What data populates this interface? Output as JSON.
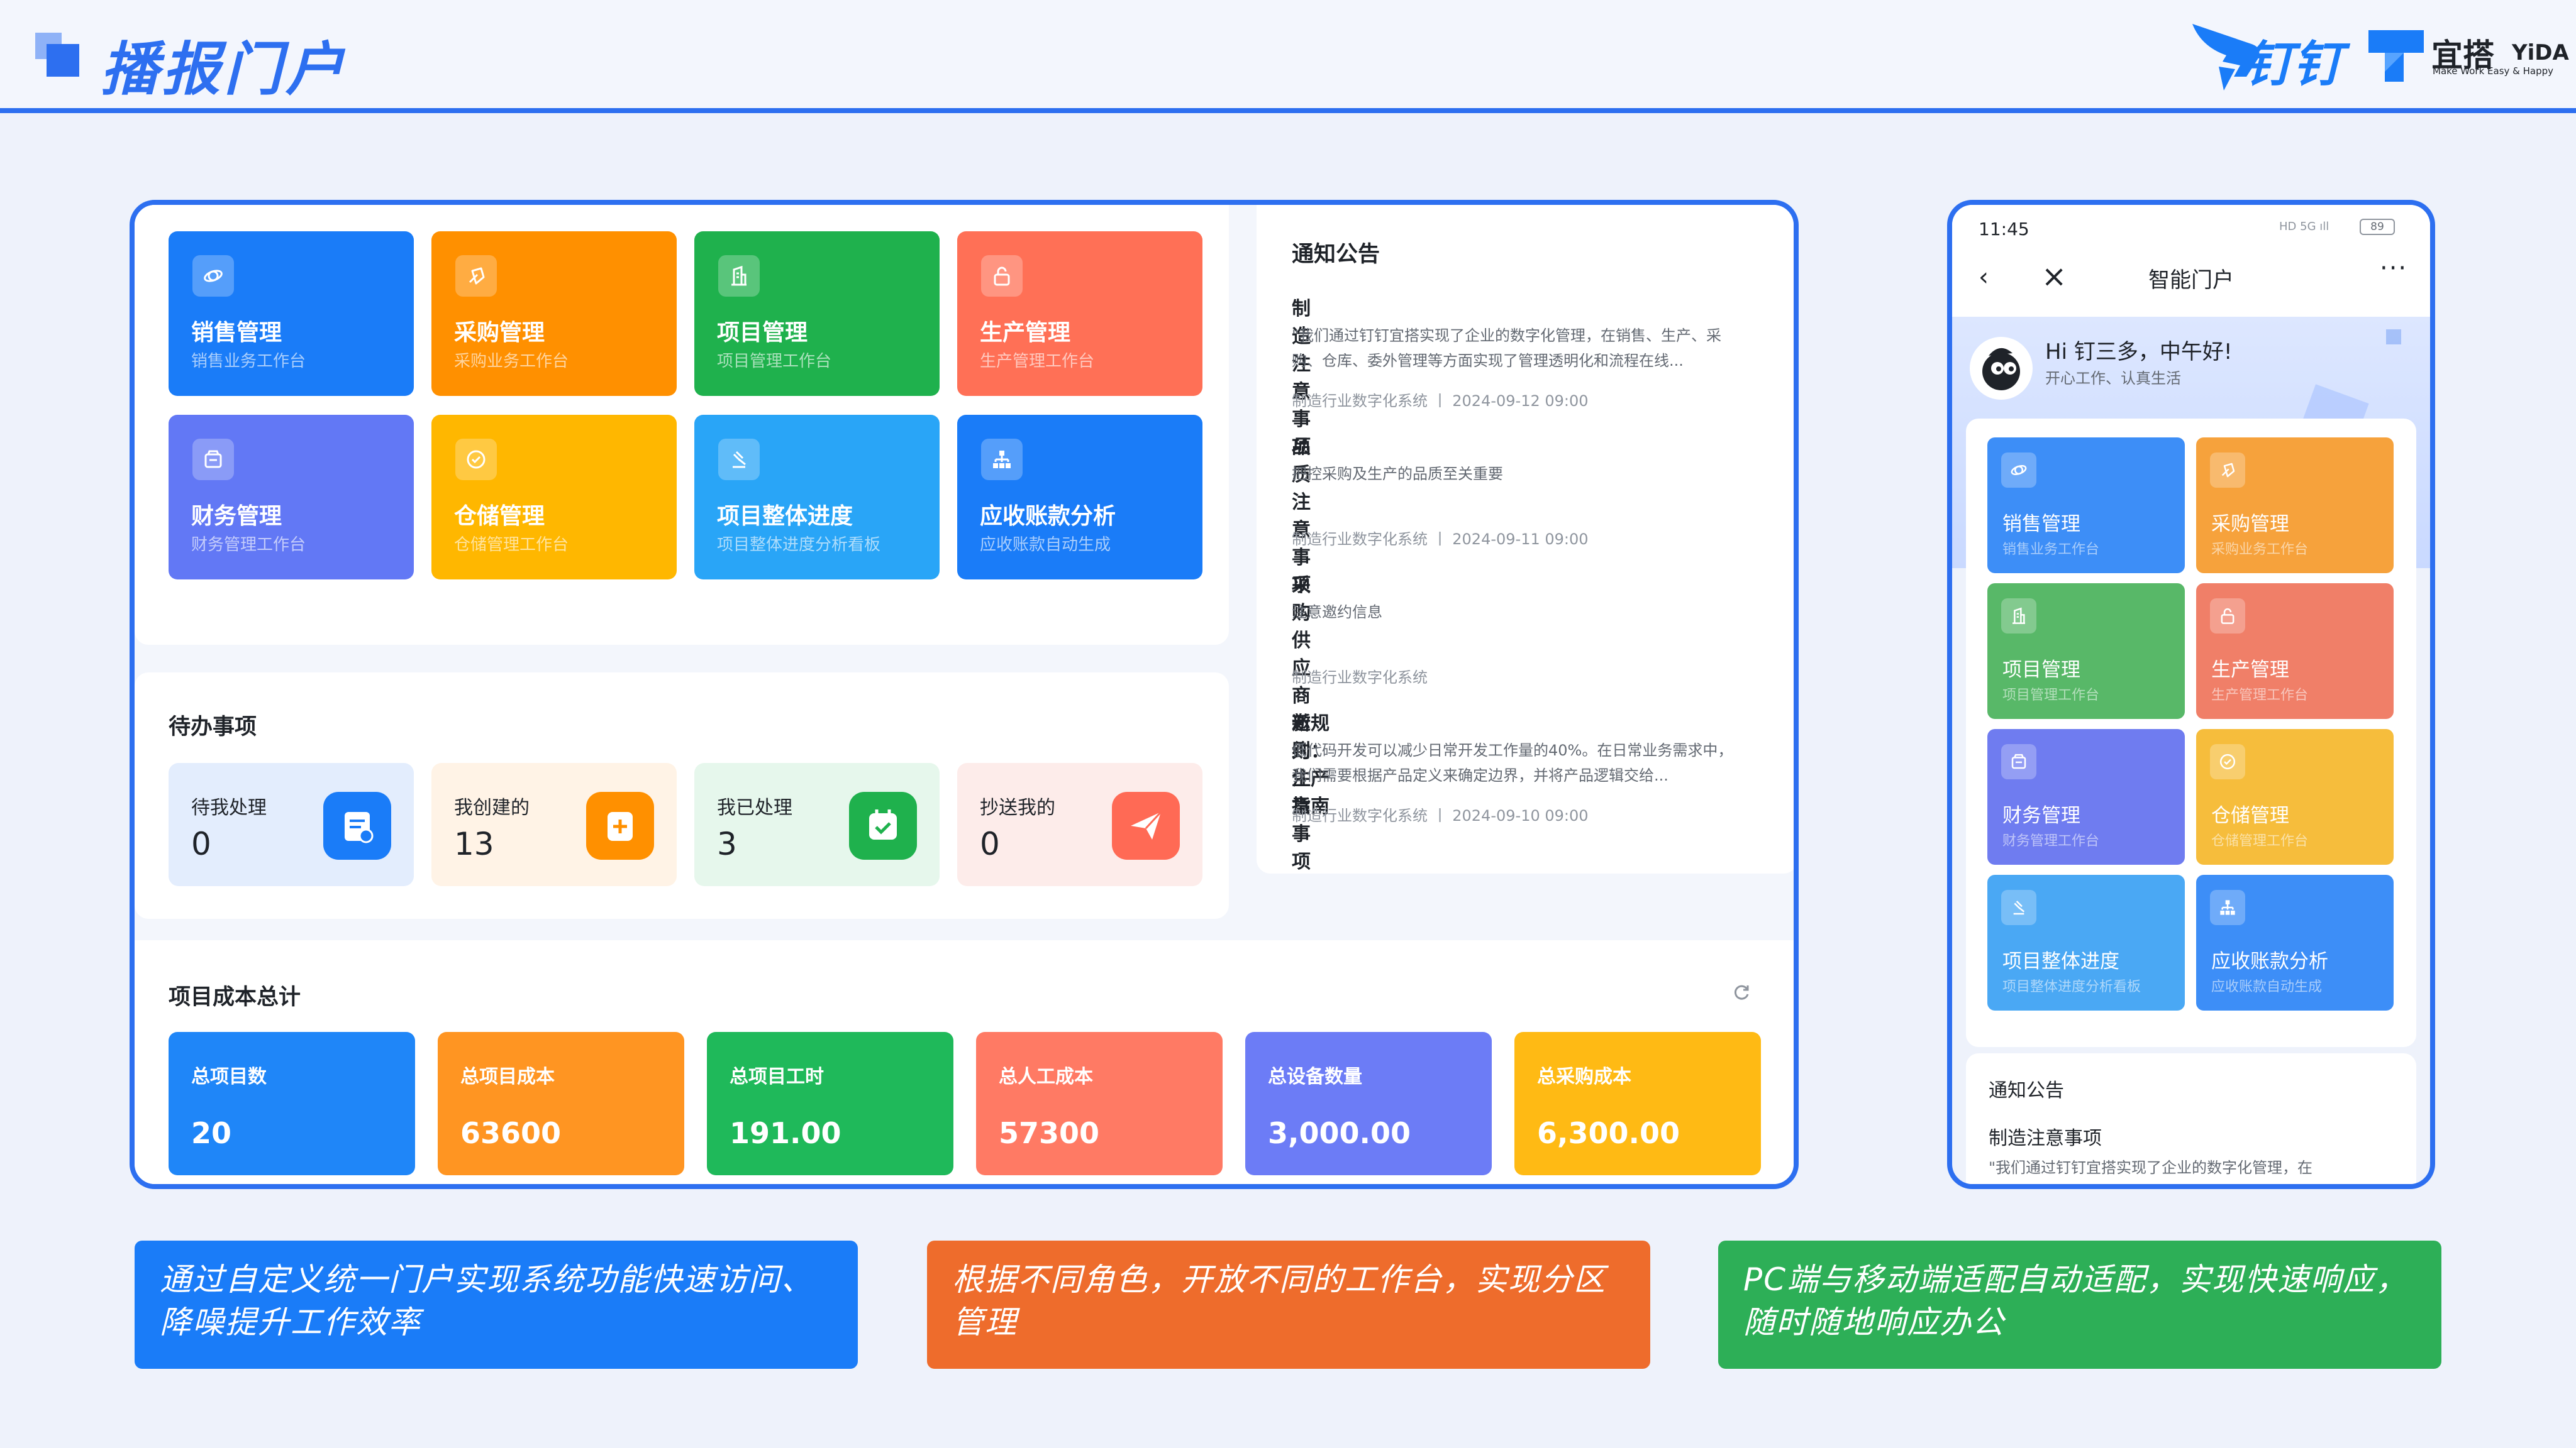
{
  "header": {
    "title": "播报门户",
    "dingtalk_label": "钉钉",
    "yida_cn": "宜搭",
    "yida_en": "YiDA",
    "yida_slogan": "Make Work Easy & Happy",
    "accent_color": "#2d6ff0"
  },
  "pc": {
    "apps": [
      {
        "title": "销售管理",
        "subtitle": "销售业务工作台",
        "color": "#1a7cf8",
        "icon": "planet-icon"
      },
      {
        "title": "采购管理",
        "subtitle": "采购业务工作台",
        "color": "#ff9000",
        "icon": "rocket-icon"
      },
      {
        "title": "项目管理",
        "subtitle": "项目管理工作台",
        "color": "#1fb14d",
        "icon": "building-icon"
      },
      {
        "title": "生产管理",
        "subtitle": "生产管理工作台",
        "color": "#ff7056",
        "icon": "lock-icon"
      },
      {
        "title": "财务管理",
        "subtitle": "财务管理工作台",
        "color": "#6278f5",
        "icon": "wallet-icon"
      },
      {
        "title": "仓储管理",
        "subtitle": "仓储管理工作台",
        "color": "#ffb700",
        "icon": "check-badge-icon"
      },
      {
        "title": "项目整体进度",
        "subtitle": "项目整体进度分析看板",
        "color": "#29a5f7",
        "icon": "gavel-icon"
      },
      {
        "title": "应收账款分析",
        "subtitle": "应收账款自动生成",
        "color": "#1a7cf8",
        "icon": "org-tree-icon"
      }
    ],
    "todo": {
      "title": "待办事项",
      "items": [
        {
          "label": "待我处理",
          "count": "0",
          "bg": "#e3edfd",
          "icon_bg": "#1a7cf8",
          "icon": "document-icon"
        },
        {
          "label": "我创建的",
          "count": "13",
          "bg": "#fff3e6",
          "icon_bg": "#ff9000",
          "icon": "clipboard-plus-icon"
        },
        {
          "label": "我已处理",
          "count": "3",
          "bg": "#e6f7ec",
          "icon_bg": "#1fb14d",
          "icon": "calendar-check-icon"
        },
        {
          "label": "抄送我的",
          "count": "0",
          "bg": "#fdecea",
          "icon_bg": "#ff6a55",
          "icon": "send-icon"
        }
      ]
    },
    "cost": {
      "title": "项目成本总计",
      "items": [
        {
          "label": "总项目数",
          "value": "20",
          "color": "#1f86f8"
        },
        {
          "label": "总项目成本",
          "value": "63600",
          "color": "#ff9522"
        },
        {
          "label": "总项目工时",
          "value": "191.00",
          "color": "#1fb95a"
        },
        {
          "label": "总人工成本",
          "value": "57300",
          "color": "#ff7a64"
        },
        {
          "label": "总设备数量",
          "value": "3,000.00",
          "color": "#6c7cf6"
        },
        {
          "label": "总采购成本",
          "value": "6,300.00",
          "color": "#ffba14"
        }
      ]
    },
    "notice": {
      "title": "通知公告",
      "items": [
        {
          "title": "制造注意事项",
          "body": "\"我们通过钉钉宜搭实现了企业的数字化管理，在销售、生产、采购、仓库、委外管理等方面实现了管理透明化和流程在线...",
          "meta": "制造行业数字化系统  丨  2024-09-12 09:00"
        },
        {
          "title": "品质注意事项",
          "body": "把控采购及生产的品质至关重要",
          "meta": "制造行业数字化系统  丨  2024-09-11 09:00"
        },
        {
          "title": "采购供应商邀约注意事项",
          "body": "注意邀约信息",
          "meta": "制造行业数字化系统"
        },
        {
          "title": "新规则：生产指南",
          "body": "低代码开发可以减少日常开发工作量的40%。在日常业务需求中，我们需要根据产品定义来确定边界，并将产品逻辑交给...",
          "meta": "制造行业数字化系统  丨  2024-09-10 09:00"
        }
      ]
    }
  },
  "mobile": {
    "time": "11:45",
    "battery": "89",
    "title": "智能门户",
    "more": "···",
    "greeting": "Hi 钉三多，中午好!",
    "subgreeting": "开心工作、认真生活",
    "apps": [
      {
        "title": "销售管理",
        "subtitle": "销售业务工作台",
        "color": "#3d8ef7",
        "icon": "planet-icon"
      },
      {
        "title": "采购管理",
        "subtitle": "采购业务工作台",
        "color": "#f6a23c",
        "icon": "rocket-icon"
      },
      {
        "title": "项目管理",
        "subtitle": "项目管理工作台",
        "color": "#58b868",
        "icon": "building-icon"
      },
      {
        "title": "生产管理",
        "subtitle": "生产管理工作台",
        "color": "#f07f68",
        "icon": "lock-icon"
      },
      {
        "title": "财务管理",
        "subtitle": "财务管理工作台",
        "color": "#6f7cf0",
        "icon": "wallet-icon"
      },
      {
        "title": "仓储管理",
        "subtitle": "仓储管理工作台",
        "color": "#f6bd3c",
        "icon": "check-badge-icon"
      },
      {
        "title": "项目整体进度",
        "subtitle": "项目整体进度分析看板",
        "color": "#4aa8f4",
        "icon": "gavel-icon"
      },
      {
        "title": "应收账款分析",
        "subtitle": "应收账款自动生成",
        "color": "#3d8ef7",
        "icon": "org-tree-icon"
      }
    ],
    "notice_title": "通知公告",
    "notice_item": "制造注意事项",
    "notice_body": "\"我们通过钉钉宜搭实现了企业的数字化管理，在"
  },
  "notes": [
    {
      "text": "通过自定义统一门户实现系统功能快速访问、降噪提升工作效率",
      "color": "#1a7cf8"
    },
    {
      "text": "根据不同角色，开放不同的工作台，实现分区管理",
      "color": "#ee6c2c"
    },
    {
      "text": "PC端与移动端适配自动适配，实现快速响应，随时随地响应办公",
      "color": "#2daf57"
    }
  ]
}
